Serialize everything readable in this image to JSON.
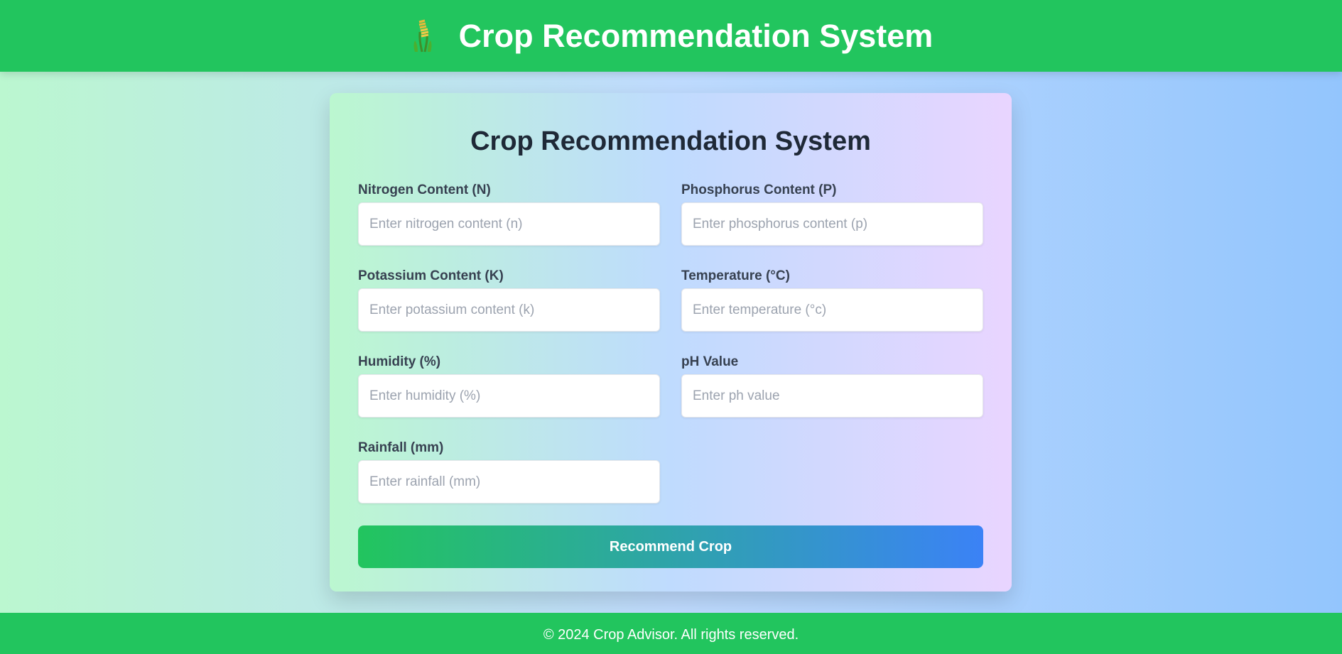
{
  "header": {
    "title": "Crop Recommendation System",
    "logo_icon": "wheat-icon"
  },
  "form": {
    "title": "Crop Recommendation System",
    "fields": [
      {
        "label": "Nitrogen Content (N)",
        "placeholder": "Enter nitrogen content (n)",
        "value": ""
      },
      {
        "label": "Phosphorus Content (P)",
        "placeholder": "Enter phosphorus content (p)",
        "value": ""
      },
      {
        "label": "Potassium Content (K)",
        "placeholder": "Enter potassium content (k)",
        "value": ""
      },
      {
        "label": "Temperature (°C)",
        "placeholder": "Enter temperature (°c)",
        "value": ""
      },
      {
        "label": "Humidity (%)",
        "placeholder": "Enter humidity (%)",
        "value": ""
      },
      {
        "label": "pH Value",
        "placeholder": "Enter ph value",
        "value": ""
      },
      {
        "label": "Rainfall (mm)",
        "placeholder": "Enter rainfall (mm)",
        "value": ""
      }
    ],
    "submit_label": "Recommend Crop"
  },
  "footer": {
    "text": "© 2024 Crop Advisor. All rights reserved."
  },
  "colors": {
    "brand_green": "#22c55e",
    "accent_blue": "#3b82f6"
  }
}
